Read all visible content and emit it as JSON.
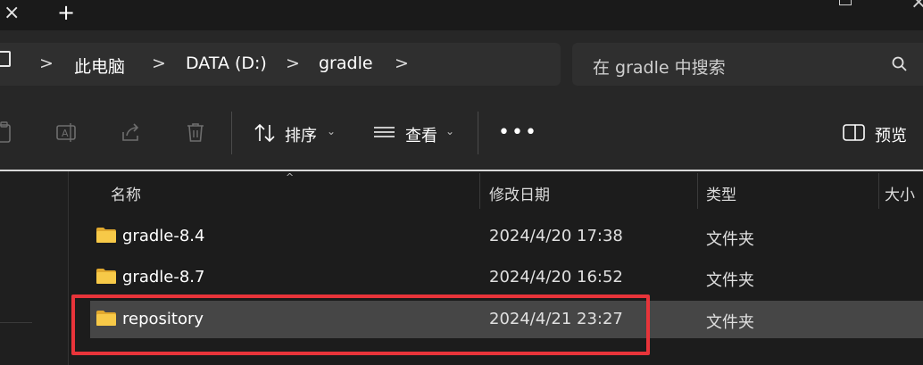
{
  "tabstrip": {
    "new_tab_glyph": "+",
    "close_glyph": "×",
    "window_close_glyph": "×"
  },
  "breadcrumb": {
    "icon": "computer-icon",
    "items": [
      "此电脑",
      "DATA (D:)",
      "gradle"
    ],
    "separator": ">"
  },
  "search": {
    "placeholder": "在 gradle 中搜索",
    "icon": "search-icon"
  },
  "toolbar": {
    "sort_label": "排序",
    "view_label": "查看",
    "more_label": "•••",
    "preview_label": "预览",
    "caret": "⌄"
  },
  "columns": {
    "name": "名称",
    "date": "修改日期",
    "type": "类型",
    "size": "大小",
    "sort_indicator": "^"
  },
  "files": [
    {
      "name": "gradle-8.4",
      "date": "2024/4/20 17:38",
      "type": "文件夹",
      "selected": false
    },
    {
      "name": "gradle-8.7",
      "date": "2024/4/20 16:52",
      "type": "文件夹",
      "selected": false
    },
    {
      "name": "repository",
      "date": "2024/4/21 23:27",
      "type": "文件夹",
      "selected": true
    }
  ],
  "colors": {
    "highlight": "#e8343a",
    "folder": "#f2c14e",
    "selected_row": "#464646"
  }
}
